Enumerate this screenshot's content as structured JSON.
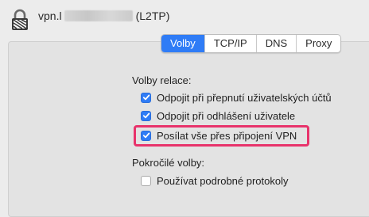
{
  "header": {
    "title_prefix": "vpn.l",
    "title_suffix": "(L2TP)",
    "icon": "vpn-lock-icon"
  },
  "tabs": [
    {
      "label": "Volby",
      "active": true
    },
    {
      "label": "TCP/IP",
      "active": false
    },
    {
      "label": "DNS",
      "active": false
    },
    {
      "label": "Proxy",
      "active": false
    }
  ],
  "session": {
    "heading": "Volby relace:",
    "options": [
      {
        "label": "Odpojit při přepnutí uživatelských účtů",
        "checked": true
      },
      {
        "label": "Odpojit při odhlášení uživatele",
        "checked": true
      },
      {
        "label": "Posílat vše přes připojení VPN",
        "checked": true
      }
    ]
  },
  "advanced": {
    "heading": "Pokročilé volby:",
    "options": [
      {
        "label": "Používat podrobné protokoly",
        "checked": false
      }
    ]
  },
  "colors": {
    "accent": "#2f7cf6",
    "highlight": "#e8336b"
  }
}
